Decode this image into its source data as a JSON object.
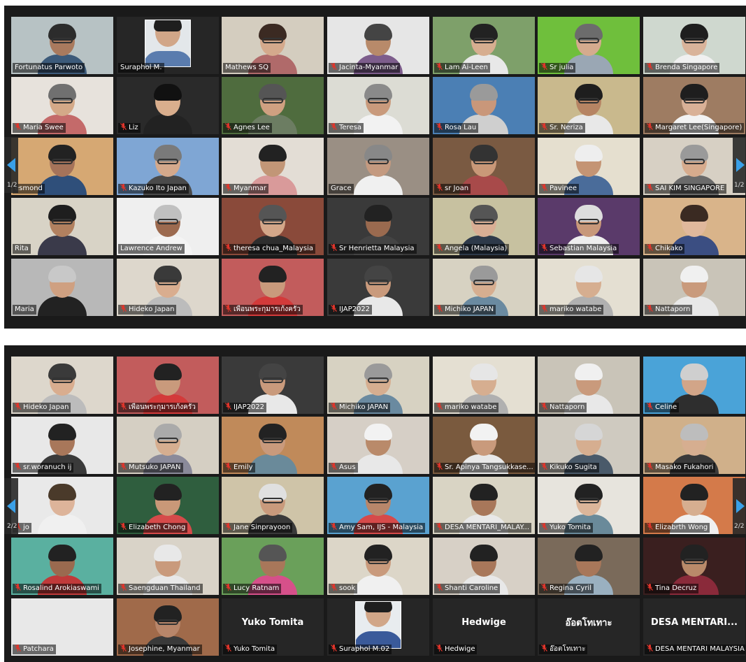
{
  "panels": [
    {
      "page_label": "1/2",
      "tiles": [
        {
          "name": "Fortunatus Parwoto",
          "muted": false,
          "bg": "#b7c2c4",
          "skin": "#a97a5e",
          "hair": "#2c2c2c",
          "shirt": "#3c5a7a",
          "glasses": true
        },
        {
          "name": "Suraphol M.",
          "muted": false,
          "bg": "#262626",
          "skin": "#d1a688",
          "hair": "#1e1e1e",
          "shirt": "#5a7cae",
          "glasses": false,
          "active": true,
          "photo": true
        },
        {
          "name": "Mathews SQ",
          "muted": false,
          "bg": "#d4cdbf",
          "skin": "#d4a98c",
          "hair": "#3b2a22",
          "shirt": "#b06a6a",
          "glasses": true
        },
        {
          "name": "Jacinta-Myanmar",
          "muted": true,
          "bg": "#e6e6e6",
          "skin": "#b88a6a",
          "hair": "#444444",
          "shirt": "#7d5d8c",
          "glasses": false
        },
        {
          "name": "Lam Ai-Leen",
          "muted": true,
          "bg": "#7ea06a",
          "skin": "#d7ae90",
          "hair": "#222222",
          "shirt": "#e8e8e8",
          "glasses": true
        },
        {
          "name": "Sr julia",
          "muted": true,
          "bg": "#6fbf3c",
          "skin": "#d5ab8e",
          "hair": "#6c6c6c",
          "shirt": "#9aa7b4",
          "glasses": true
        },
        {
          "name": "Brenda Singapore",
          "muted": true,
          "bg": "#cfd8cf",
          "skin": "#d9b39a",
          "hair": "#1e1e1e",
          "shirt": "#f0f0f0",
          "glasses": true
        },
        {
          "name": "Maria Swee",
          "muted": true,
          "bg": "#e7e2dc",
          "skin": "#d4a988",
          "hair": "#707070",
          "shirt": "#c46a6a",
          "glasses": true
        },
        {
          "name": "Liz",
          "muted": true,
          "bg": "#2a2a2a",
          "skin": "#d9ae8d",
          "hair": "#111111",
          "shirt": "#222222",
          "glasses": false
        },
        {
          "name": "Agnes Lee",
          "muted": true,
          "bg": "#4f6c3e",
          "skin": "#cfa081",
          "hair": "#555555",
          "shirt": "#6c7d62",
          "glasses": true
        },
        {
          "name": "Teresa",
          "muted": true,
          "bg": "#dcdcd4",
          "skin": "#c99a7c",
          "hair": "#8a8a8a",
          "shirt": "#f2f2f2",
          "glasses": true
        },
        {
          "name": "Rosa Lau",
          "muted": true,
          "bg": "#4b7fb4",
          "skin": "#c9977a",
          "hair": "#9a9a9a",
          "shirt": "#cfcfcf",
          "glasses": false
        },
        {
          "name": "Sr. Neriza",
          "muted": true,
          "bg": "#c9b98d",
          "skin": "#b68463",
          "hair": "#1e1e1e",
          "shirt": "#e8e8e8",
          "glasses": true
        },
        {
          "name": "Margaret Lee(Singapore)",
          "muted": true,
          "bg": "#9e7c62",
          "skin": "#d9b197",
          "hair": "#1e1e1e",
          "shirt": "#f2f2f2",
          "glasses": true
        },
        {
          "name": "esmond",
          "muted": false,
          "bg": "#d6a873",
          "skin": "#a5735a",
          "hair": "#222222",
          "shirt": "#2f4f7a",
          "glasses": true
        },
        {
          "name": "Kazuko Ito   Japan",
          "muted": true,
          "bg": "#7fa6d4",
          "skin": "#d4a98c",
          "hair": "#7a7a7a",
          "shirt": "#4a4a4a",
          "glasses": true
        },
        {
          "name": "Myanmar",
          "muted": true,
          "bg": "#e3ddd5",
          "skin": "#c29677",
          "hair": "#222222",
          "shirt": "#d99a9a",
          "glasses": false
        },
        {
          "name": "Grace",
          "muted": false,
          "bg": "#9a8f84",
          "skin": "#c49a80",
          "hair": "#888888",
          "shirt": "#f0f0f0",
          "glasses": true
        },
        {
          "name": "sr Joan",
          "muted": true,
          "bg": "#7a5a42",
          "skin": "#c99878",
          "hair": "#333333",
          "shirt": "#a84a4a",
          "glasses": true
        },
        {
          "name": "Pavinee",
          "muted": true,
          "bg": "#e5dfcf",
          "skin": "#c49474",
          "hair": "#eeeeee",
          "shirt": "#4a6c9a",
          "glasses": false
        },
        {
          "name": "SAI KIM SINGAPORE",
          "muted": true,
          "bg": "#d7d0c4",
          "skin": "#d6ab8d",
          "hair": "#9a9a9a",
          "shirt": "#6a6a6a",
          "glasses": true
        },
        {
          "name": "Rita",
          "muted": false,
          "bg": "#d8d3c6",
          "skin": "#b1805f",
          "hair": "#1e1e1e",
          "shirt": "#3a3a4a",
          "glasses": true
        },
        {
          "name": "Lawrence Andrew",
          "muted": false,
          "bg": "#efefef",
          "skin": "#9c6a4f",
          "hair": "#c0c0c0",
          "shirt": "#f4f4f4",
          "glasses": true
        },
        {
          "name": "theresa chua_Malaysia",
          "muted": true,
          "bg": "#8a4a3a",
          "skin": "#d3a789",
          "hair": "#555555",
          "shirt": "#2e2e2e",
          "glasses": true
        },
        {
          "name": "Sr Henrietta Malaysia",
          "muted": true,
          "bg": "#3a3a3a",
          "skin": "#9a6a4f",
          "hair": "#222222",
          "shirt": "#444444",
          "glasses": false
        },
        {
          "name": "Angela (Malaysia)",
          "muted": true,
          "bg": "#c7c1a0",
          "skin": "#d9ae94",
          "hair": "#555555",
          "shirt": "#2e3a4a",
          "glasses": true
        },
        {
          "name": "Sebastian Malaysia",
          "muted": true,
          "bg": "#5a3a6a",
          "skin": "#c8987a",
          "hair": "#dddddd",
          "shirt": "#eeeeee",
          "glasses": true
        },
        {
          "name": "Chikako",
          "muted": true,
          "bg": "#d9b48a",
          "skin": "#e0b89c",
          "hair": "#3a2a22",
          "shirt": "#3b4e82",
          "glasses": false
        },
        {
          "name": "Maria",
          "muted": false,
          "bg": "#b8b8b8",
          "skin": "#cfa081",
          "hair": "#c8c8c8",
          "shirt": "#222222",
          "glasses": false
        },
        {
          "name": "Hideko Japan",
          "muted": true,
          "bg": "#ddd7cc",
          "skin": "#d9ad8f",
          "hair": "#3a3a3a",
          "shirt": "#bcbcbc",
          "glasses": true
        },
        {
          "name": "เพื่อนพระกุมารเก้งครัว",
          "muted": true,
          "bg": "#c25c5c",
          "skin": "#c99a7c",
          "hair": "#222222",
          "shirt": "#d33a3a",
          "glasses": false
        },
        {
          "name": "IJAP2022",
          "muted": true,
          "bg": "#3a3a3a",
          "skin": "#c99a7c",
          "hair": "#444444",
          "shirt": "#e8e8e8",
          "glasses": true
        },
        {
          "name": "Michiko JAPAN",
          "muted": true,
          "bg": "#d7d2c2",
          "skin": "#d6ae90",
          "hair": "#9a9a9a",
          "shirt": "#6a8aa0",
          "glasses": true
        },
        {
          "name": "mariko watabe",
          "muted": true,
          "bg": "#e4dfd2",
          "skin": "#d6ae90",
          "hair": "#e6e6e6",
          "shirt": "#b0b0b0",
          "glasses": false
        },
        {
          "name": "Nattaporn",
          "muted": true,
          "bg": "#c9c4b8",
          "skin": "#c99a7c",
          "hair": "#f0f0f0",
          "shirt": "#e8e8e8",
          "glasses": false
        }
      ]
    },
    {
      "page_label": "2/2",
      "tiles": [
        {
          "name": "Hideko Japan",
          "muted": true,
          "bg": "#ddd7cc",
          "skin": "#d9ad8f",
          "hair": "#3a3a3a",
          "shirt": "#bcbcbc",
          "glasses": true
        },
        {
          "name": "เพื่อนพระกุมารเก้งครัว",
          "muted": true,
          "bg": "#c25c5c",
          "skin": "#c99a7c",
          "hair": "#222222",
          "shirt": "#d33a3a",
          "glasses": false
        },
        {
          "name": "IJAP2022",
          "muted": true,
          "bg": "#3a3a3a",
          "skin": "#c99a7c",
          "hair": "#444444",
          "shirt": "#e8e8e8",
          "glasses": true
        },
        {
          "name": "Michiko JAPAN",
          "muted": true,
          "bg": "#d7d2c2",
          "skin": "#d6ae90",
          "hair": "#9a9a9a",
          "shirt": "#6a8aa0",
          "glasses": true
        },
        {
          "name": "mariko watabe",
          "muted": true,
          "bg": "#e4dfd2",
          "skin": "#d6ae90",
          "hair": "#e6e6e6",
          "shirt": "#b0b0b0",
          "glasses": false
        },
        {
          "name": "Nattaporn",
          "muted": true,
          "bg": "#c9c4b8",
          "skin": "#c99a7c",
          "hair": "#f0f0f0",
          "shirt": "#e8e8e8",
          "glasses": false
        },
        {
          "name": "Celine",
          "muted": true,
          "bg": "#4aa3d8",
          "skin": "#d2a588",
          "hair": "#cfcfcf",
          "shirt": "#2e2e2e",
          "glasses": false
        },
        {
          "name": "sr.woranuch ij",
          "muted": true,
          "bg": "#e8e8e8",
          "skin": "#a8775a",
          "hair": "#222222",
          "shirt": "#3a3a3a",
          "glasses": false
        },
        {
          "name": "Mutsuko JAPAN",
          "muted": true,
          "bg": "#d5cfc3",
          "skin": "#d6ae90",
          "hair": "#aaaaaa",
          "shirt": "#8a8a9a",
          "glasses": true
        },
        {
          "name": "Emily",
          "muted": true,
          "bg": "#c08a5a",
          "skin": "#c99a7c",
          "hair": "#222222",
          "shirt": "#6a8a9a",
          "glasses": true
        },
        {
          "name": "Asus",
          "muted": true,
          "bg": "#d6cfc6",
          "skin": "#b98a6a",
          "hair": "#f2f2f2",
          "shirt": "#e8e8e8",
          "glasses": false
        },
        {
          "name": "Sr. Apinya Tangsukkase...",
          "muted": true,
          "bg": "#7a5a3e",
          "skin": "#c99a7c",
          "hair": "#f2f2f2",
          "shirt": "#e8e8e8",
          "glasses": false
        },
        {
          "name": "Kikuko Sugita",
          "muted": true,
          "bg": "#cfcac0",
          "skin": "#d6ae90",
          "hair": "#d6d6d6",
          "shirt": "#4a5a6a",
          "glasses": false
        },
        {
          "name": "Masako Fukahori",
          "muted": true,
          "bg": "#d0b08a",
          "skin": "#d6ae90",
          "hair": "#bdbdbd",
          "shirt": "#3a3a3a",
          "glasses": false
        },
        {
          "name": "jo",
          "muted": true,
          "bg": "#e9e9e9",
          "skin": "#ddb49a",
          "hair": "#4a3a2a",
          "shirt": "#f0f0f0",
          "glasses": false
        },
        {
          "name": "Elizabeth Chong",
          "muted": true,
          "bg": "#2f5e3e",
          "skin": "#c99878",
          "hair": "#222222",
          "shirt": "#d64a4a",
          "glasses": false
        },
        {
          "name": "Jane  Sinprayoon",
          "muted": true,
          "bg": "#cfc4a8",
          "skin": "#c99a7c",
          "hair": "#e0e0e0",
          "shirt": "#3a3a3a",
          "glasses": true
        },
        {
          "name": "Amy Sam, IJS - Malaysia",
          "muted": true,
          "bg": "#5aa2d0",
          "skin": "#b8866a",
          "hair": "#222222",
          "shirt": "#d64a4a",
          "glasses": true
        },
        {
          "name": "DESA MENTARI_MALAY...",
          "muted": true,
          "bg": "#d9d4c4",
          "skin": "#a8775a",
          "hair": "#222222",
          "shirt": "#e8e8e8",
          "glasses": false
        },
        {
          "name": "Yuko Tomita",
          "muted": true,
          "bg": "#e7e4dd",
          "skin": "#dcb69a",
          "hair": "#222222",
          "shirt": "#6a8a9a",
          "glasses": true
        },
        {
          "name": "Elizabrth Wong",
          "muted": true,
          "bg": "#d47a4a",
          "skin": "#d6ae90",
          "hair": "#222222",
          "shirt": "#f0f0f0",
          "glasses": false
        },
        {
          "name": "Rosalind Arokiaswami",
          "muted": true,
          "bg": "#5ab0a0",
          "skin": "#9a6a4f",
          "hair": "#222222",
          "shirt": "#c03a3a",
          "glasses": false
        },
        {
          "name": "Saengduan Thailand",
          "muted": true,
          "bg": "#d9d3c8",
          "skin": "#c99a7c",
          "hair": "#e8e8e8",
          "shirt": "#e8e8e8",
          "glasses": false
        },
        {
          "name": "Lucy Ratnam",
          "muted": true,
          "bg": "#6aa05a",
          "skin": "#a8775a",
          "hair": "#555555",
          "shirt": "#d6508a",
          "glasses": false
        },
        {
          "name": "sook",
          "muted": true,
          "bg": "#dcd6c8",
          "skin": "#c99a7c",
          "hair": "#222222",
          "shirt": "#f0f0f0",
          "glasses": true
        },
        {
          "name": "Shanti Caroline",
          "muted": true,
          "bg": "#d7d0c6",
          "skin": "#a8775a",
          "hair": "#222222",
          "shirt": "#e8e8e8",
          "glasses": false
        },
        {
          "name": "Regina Cyril",
          "muted": true,
          "bg": "#7a6a5a",
          "skin": "#a8775a",
          "hair": "#222222",
          "shirt": "#9ab0c0",
          "glasses": false
        },
        {
          "name": "Tina Decruz",
          "muted": true,
          "bg": "#3a1f1f",
          "skin": "#b98a6a",
          "hair": "#222222",
          "shirt": "#8a2a3a",
          "glasses": true
        },
        {
          "name": "Patchara",
          "muted": true,
          "bg": "#e8e8e8",
          "skin": "#c99a7c",
          "hair": "#222222",
          "shirt": "#e8e8e8",
          "glasses": false,
          "noface": true
        },
        {
          "name": "Josephine, Myanmar",
          "muted": true,
          "bg": "#a06a4a",
          "skin": "#b8866a",
          "hair": "#222222",
          "shirt": "#3a3a3a",
          "glasses": true
        },
        {
          "name": "Yuko Tomita",
          "muted": true,
          "textonly": "Yuko Tomita"
        },
        {
          "name": "Suraphol M.02",
          "muted": true,
          "textonly": "",
          "photo": true
        },
        {
          "name": "Hedwige",
          "muted": true,
          "textonly": "Hedwige"
        },
        {
          "name": "อ๊อตโทเทาะ",
          "muted": true,
          "textonly": "อ๊อตโทเทาะ"
        },
        {
          "name": "DESA MENTARI MALAYSIA",
          "muted": true,
          "textonly": "DESA  MENTARI..."
        }
      ]
    }
  ],
  "colors": {
    "active_outline": "#d8e84a",
    "mute_red": "#e0352b",
    "nav_blue": "#3aa0e8"
  }
}
